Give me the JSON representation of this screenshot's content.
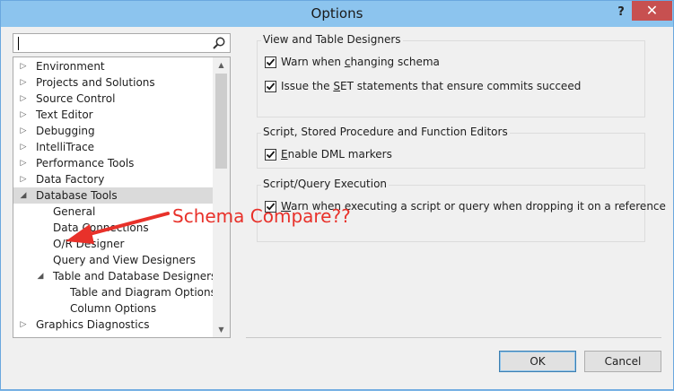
{
  "window": {
    "title": "Options",
    "help_glyph": "?",
    "close_glyph": "✕"
  },
  "search": {
    "value": "",
    "placeholder": ""
  },
  "tree": {
    "items": [
      {
        "label": "Environment",
        "expander": "collapsed"
      },
      {
        "label": "Projects and Solutions",
        "expander": "collapsed"
      },
      {
        "label": "Source Control",
        "expander": "collapsed"
      },
      {
        "label": "Text Editor",
        "expander": "collapsed"
      },
      {
        "label": "Debugging",
        "expander": "collapsed"
      },
      {
        "label": "IntelliTrace",
        "expander": "collapsed"
      },
      {
        "label": "Performance Tools",
        "expander": "collapsed"
      },
      {
        "label": "Data Factory",
        "expander": "collapsed"
      },
      {
        "label": "Database Tools",
        "expander": "expanded",
        "selected": true
      },
      {
        "label": "General",
        "expander": "none"
      },
      {
        "label": "Data Connections",
        "expander": "none"
      },
      {
        "label": "O/R Designer",
        "expander": "none"
      },
      {
        "label": "Query and View Designers",
        "expander": "none"
      },
      {
        "label": "Table and Database Designers",
        "expander": "expanded"
      },
      {
        "label": "Table and Diagram Options",
        "expander": "none"
      },
      {
        "label": "Column Options",
        "expander": "none"
      },
      {
        "label": "Graphics Diagnostics",
        "expander": "collapsed"
      }
    ]
  },
  "groups": {
    "view_table": {
      "title": "View and Table Designers",
      "options": [
        {
          "pre": "Warn when ",
          "accel": "c",
          "post": "hanging schema",
          "checked": true
        },
        {
          "pre": "Issue the ",
          "accel": "S",
          "post": "ET statements that ensure commits succeed",
          "checked": true
        }
      ]
    },
    "script_editors": {
      "title": "Script, Stored Procedure and Function Editors",
      "options": [
        {
          "pre": "",
          "accel": "E",
          "post": "nable DML markers",
          "checked": true
        }
      ]
    },
    "script_exec": {
      "title": "Script/Query Execution",
      "options": [
        {
          "pre": "",
          "accel": "W",
          "post": "arn when executing a script or query when dropping it on a reference",
          "checked": true
        }
      ]
    }
  },
  "buttons": {
    "ok": "OK",
    "cancel": "Cancel"
  },
  "annotation": {
    "text": "Schema Compare??",
    "color": "#e8312a"
  },
  "colors": {
    "titlebar": "#8cc4ee",
    "close": "#c75050",
    "selection": "#dadada"
  }
}
